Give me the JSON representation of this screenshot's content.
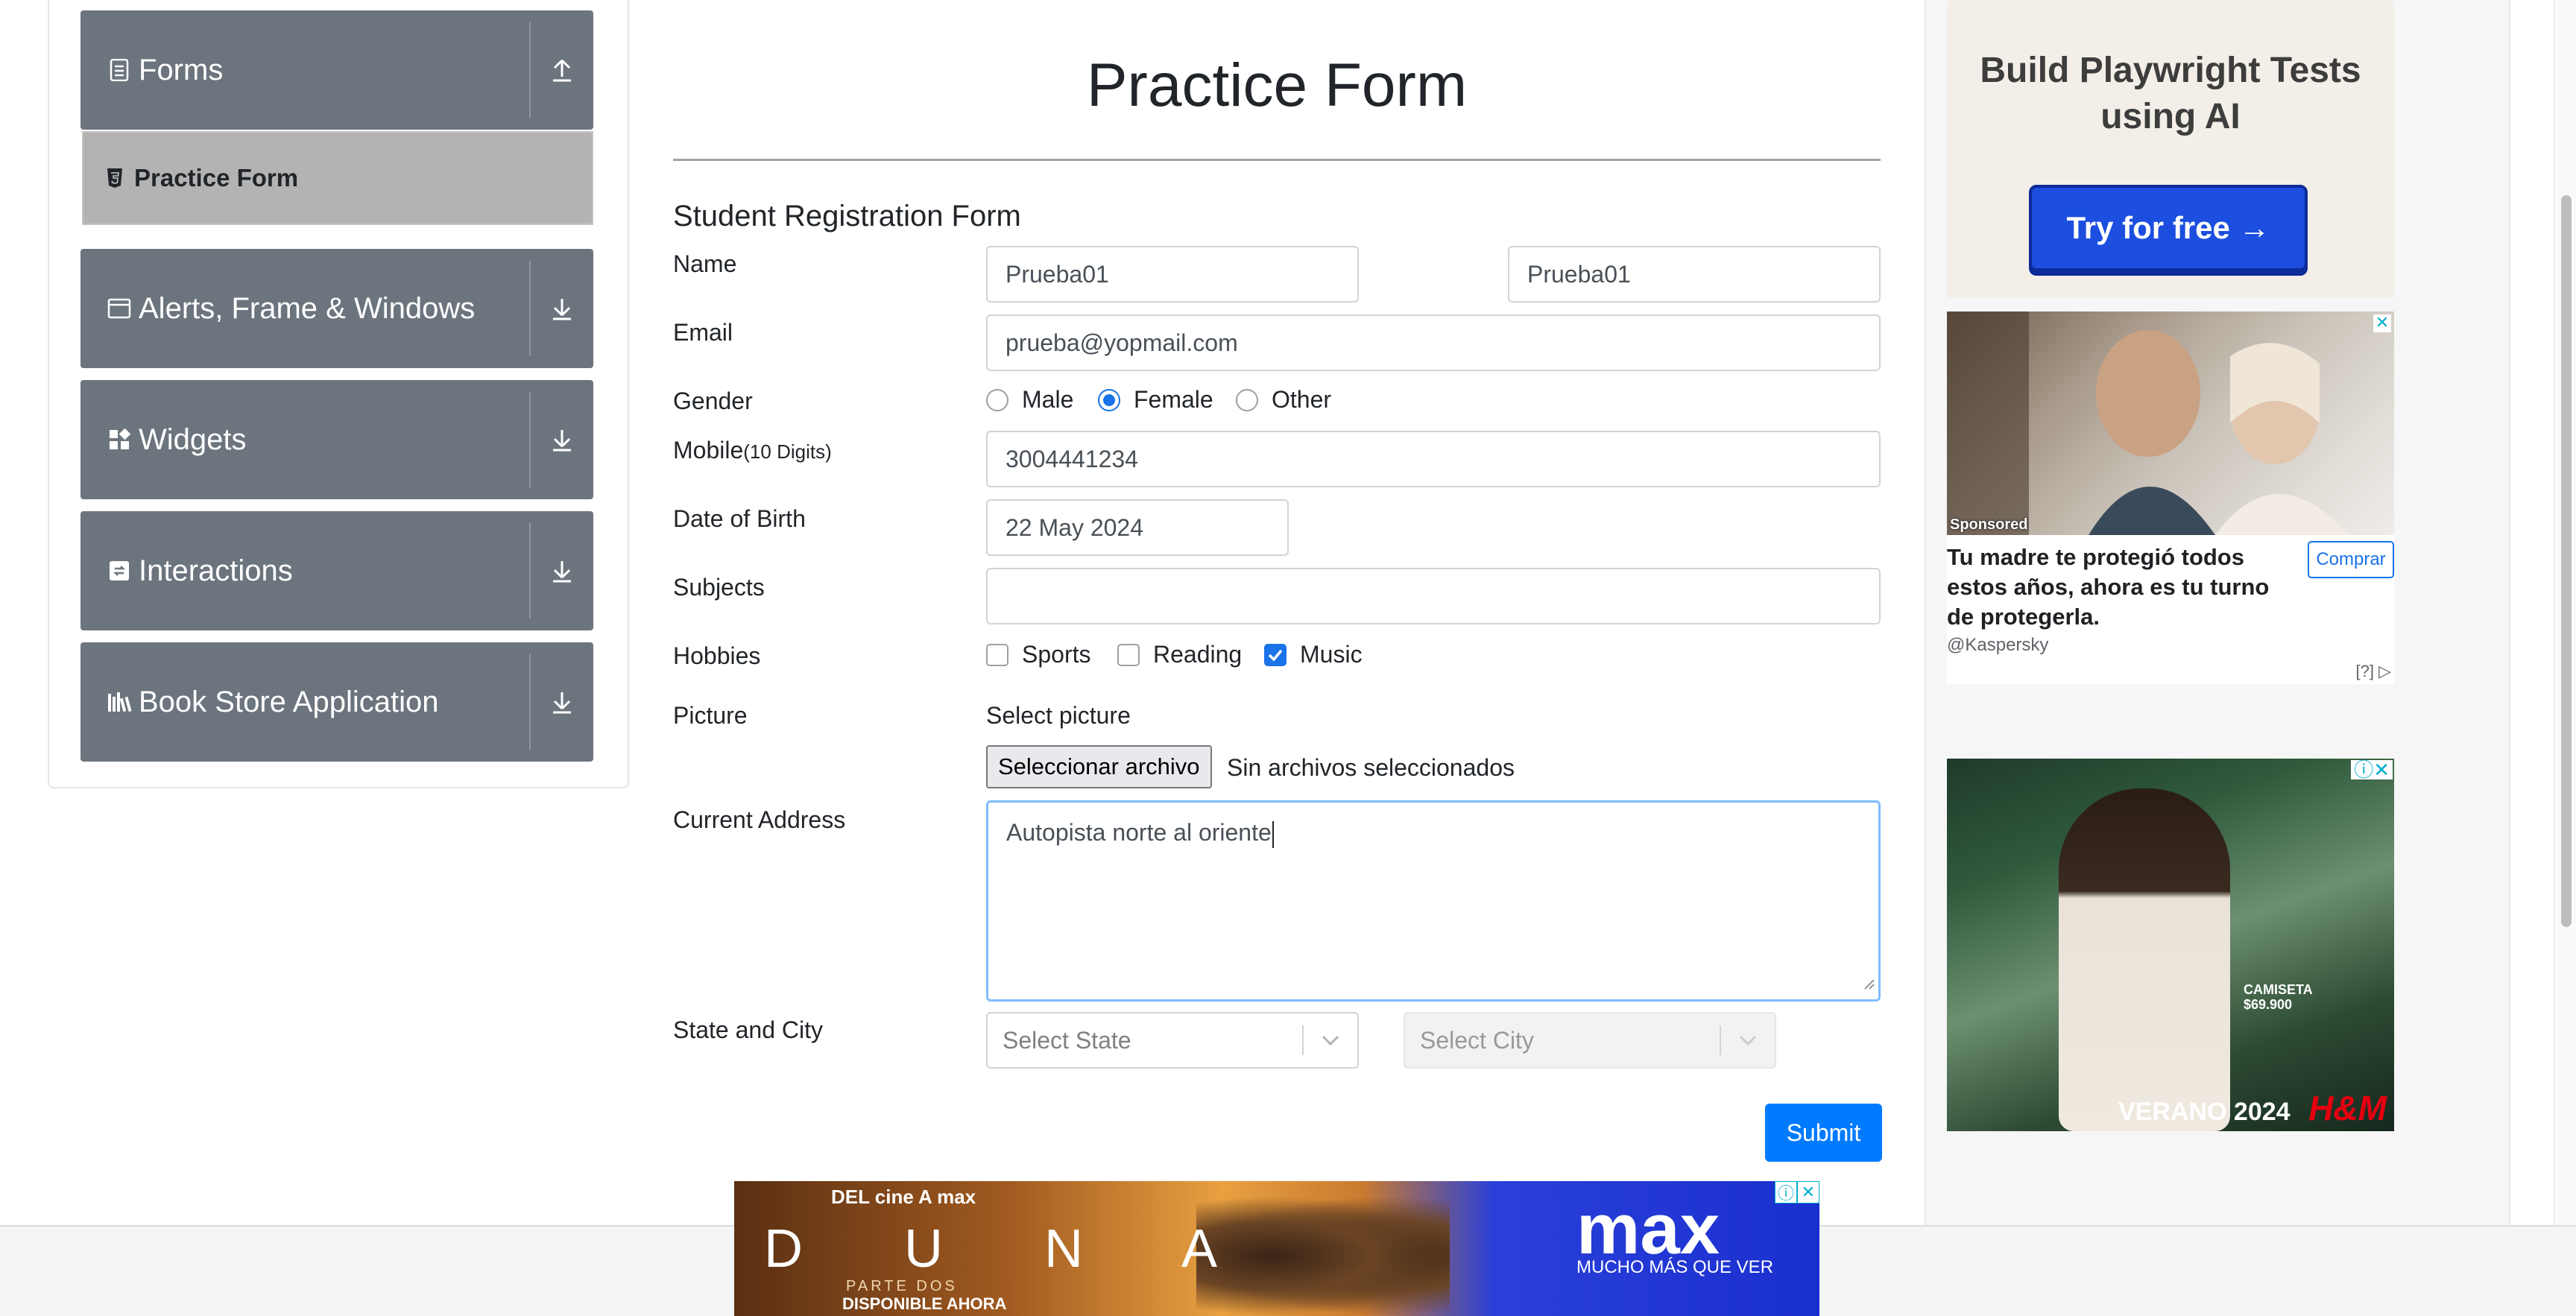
{
  "sidebar": {
    "groups": [
      {
        "title": "Forms",
        "icon": "document-icon",
        "toggle": "collapse-arrow-up-icon"
      },
      {
        "title": "Alerts, Frame & Windows",
        "icon": "window-icon",
        "toggle": "expand-arrow-down-icon"
      },
      {
        "title": "Widgets",
        "icon": "widgets-grid-icon",
        "toggle": "expand-arrow-down-icon"
      },
      {
        "title": "Interactions",
        "icon": "interactions-icon",
        "toggle": "expand-arrow-down-icon"
      },
      {
        "title": "Book Store Application",
        "icon": "books-icon",
        "toggle": "expand-arrow-down-icon"
      }
    ],
    "active_item": {
      "label": "Practice Form",
      "icon": "html5-icon"
    }
  },
  "form": {
    "page_title": "Practice Form",
    "section_title": "Student Registration Form",
    "labels": {
      "name": "Name",
      "email": "Email",
      "gender": "Gender",
      "mobile": "Mobile",
      "mobile_hint": "(10 Digits)",
      "dob": "Date of Birth",
      "subjects": "Subjects",
      "hobbies": "Hobbies",
      "picture": "Picture",
      "address": "Current Address",
      "state_city": "State and City"
    },
    "values": {
      "first_name": "Prueba01",
      "last_name": "Prueba01",
      "email": "prueba@yopmail.com",
      "mobile": "3004441234",
      "dob": "22 May 2024",
      "subjects": "",
      "address": "Autopista norte al oriente"
    },
    "gender_options": [
      {
        "label": "Male",
        "checked": false
      },
      {
        "label": "Female",
        "checked": true
      },
      {
        "label": "Other",
        "checked": false
      }
    ],
    "hobby_options": [
      {
        "label": "Sports",
        "checked": false
      },
      {
        "label": "Reading",
        "checked": false
      },
      {
        "label": "Music",
        "checked": true
      }
    ],
    "picture": {
      "select_label": "Select picture",
      "button_label": "Seleccionar archivo",
      "status": "Sin archivos seleccionados"
    },
    "state_placeholder": "Select State",
    "city_placeholder": "Select City",
    "submit_label": "Submit"
  },
  "ads": {
    "ad1": {
      "headline": "Build Playwright Tests using AI",
      "cta": "Try for free →"
    },
    "ad2": {
      "sponsored": "Sponsored",
      "text": "Tu madre te protegió todos estos años, ahora es tu turno de protegerla.",
      "button": "Comprar",
      "source": "@Kaspersky",
      "info": "[?]"
    },
    "ad3": {
      "tag_line1": "CAMISETA",
      "tag_line2": "$69.900",
      "brand": "VERANO 2024",
      "logo": "H&M"
    },
    "banner": {
      "top": "DEL cine A max",
      "title": "D U N A",
      "subtitle": "PARTE DOS",
      "availability": "DISPONIBLE AHORA",
      "brand": "max",
      "slogan": "MUCHO MÁS QUE VER"
    }
  },
  "colors": {
    "sidebar_header": "#6c757d",
    "active_item_bg": "#b3b3b3",
    "primary": "#007bff",
    "checked": "#1a73e8",
    "focus_border": "#80bdff"
  }
}
